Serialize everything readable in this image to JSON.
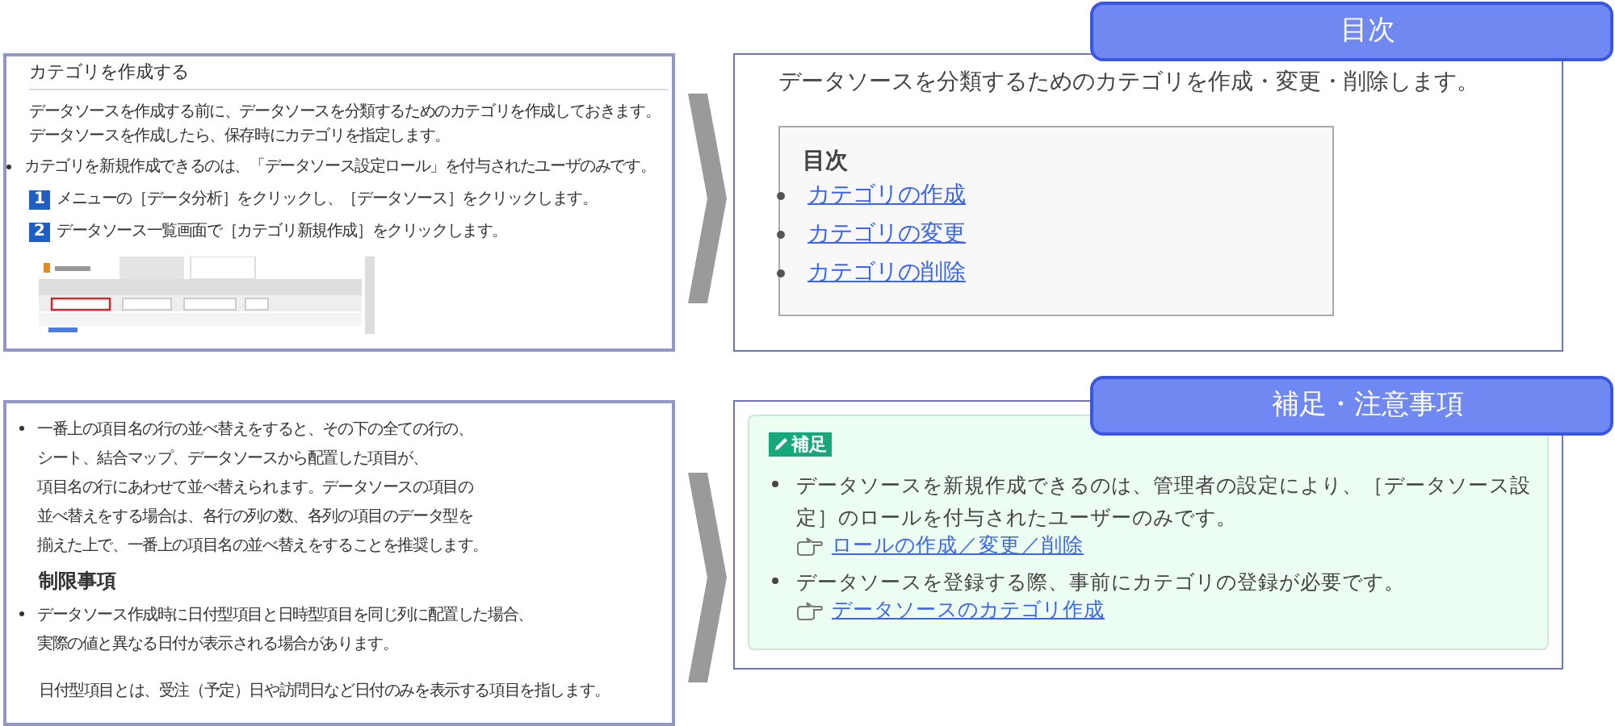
{
  "manual_page": {
    "heading": "カテゴリを作成する",
    "intro": [
      "データソースを作成する前に、データソースを分類するためのカテゴリを作成しておきます。",
      "データソースを作成したら、保存時にカテゴリを指定します。"
    ],
    "bullet": "カテゴリを新規作成できるのは、「データソース設定ロール」を付与されたユーザのみです。",
    "steps": [
      {
        "number": "1",
        "text": "メニューの［データ分析］をクリックし、［データソース］をクリックします。"
      },
      {
        "number": "2",
        "text": "データソース一覧画面で［カテゴリ新規作成］をクリックします。"
      }
    ]
  },
  "notes_page": {
    "bullets_top": [
      [
        "一番上の項目名の行の並べ替えをすると、その下の全ての行の、",
        "シート、結合マップ、データソースから配置した項目が、",
        "項目名の行にあわせて並べ替えられます。データソースの項目の",
        "並べ替えをする場合は、各行の列の数、各列の項目のデータ型を",
        "揃えた上で、一番上の項目名の並べ替えをすることを推奨します。"
      ]
    ],
    "heading": "制限事項",
    "bullets_bottom": [
      [
        "データソース作成時に日付型項目と日時型項目を同じ列に配置した場合、",
        "実際の値と異なる日付が表示される場合があります。"
      ]
    ],
    "note": "日付型項目とは、受注（予定）日や訪問日など日付のみを表示する項目を指します。"
  },
  "toc_page": {
    "badge": "目次",
    "intro": "データソースを分類するためのカテゴリを作成・変更・削除します。",
    "toc_title": "目次",
    "links": [
      "カテゴリの作成",
      "カテゴリの変更",
      "カテゴリの削除"
    ]
  },
  "supplement_page": {
    "badge": "補足・注意事項",
    "tag": "補足",
    "items": [
      {
        "lines": [
          "データソースを新規作成できるのは、管理者の設定により、［データソース設",
          "定］のロールを付与されたユーザーのみです。"
        ],
        "link": "ロールの作成／変更／削除"
      },
      {
        "lines": [
          "データソースを登録する際、事前にカテゴリの登録が必要です。"
        ],
        "link": "データソースのカテゴリ作成"
      }
    ]
  }
}
